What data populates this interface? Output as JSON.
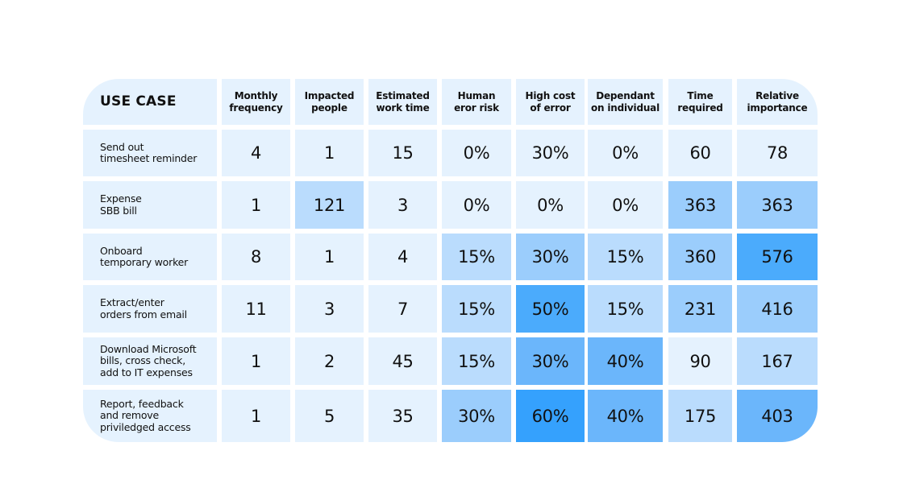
{
  "chart_data": {
    "type": "heatmap",
    "title": "",
    "corner_header": "USE CASE",
    "columns": [
      "Monthly\nfrequency",
      "Impacted\npeople",
      "Estimated\nwork time",
      "Human\neror risk",
      "High cost\nof error",
      "Dependant\non individual",
      "Time\nrequired",
      "Relative\nimportance"
    ],
    "rows": [
      {
        "label": "Send out\ntimesheet reminder",
        "values": [
          "4",
          "1",
          "15",
          "0%",
          "30%",
          "0%",
          "60",
          "78"
        ],
        "shades": [
          0,
          0,
          0,
          0,
          0,
          0,
          0,
          0
        ]
      },
      {
        "label": "Expense\nSBB bill",
        "values": [
          "1",
          "121",
          "3",
          "0%",
          "0%",
          "0%",
          "363",
          "363"
        ],
        "shades": [
          0,
          1,
          0,
          0,
          0,
          0,
          2,
          2
        ]
      },
      {
        "label": "Onboard\ntemporary worker",
        "values": [
          "8",
          "1",
          "4",
          "15%",
          "30%",
          "15%",
          "360",
          "576"
        ],
        "shades": [
          0,
          0,
          0,
          1,
          2,
          1,
          2,
          4
        ]
      },
      {
        "label": "Extract/enter\norders from email",
        "values": [
          "11",
          "3",
          "7",
          "15%",
          "50%",
          "15%",
          "231",
          "416"
        ],
        "shades": [
          0,
          0,
          0,
          1,
          4,
          1,
          2,
          2
        ]
      },
      {
        "label": "Download Microsoft\nbills, cross check,\nadd to IT expenses",
        "values": [
          "1",
          "2",
          "45",
          "15%",
          "30%",
          "40%",
          "90",
          "167"
        ],
        "shades": [
          0,
          0,
          0,
          1,
          3,
          3,
          0,
          1
        ]
      },
      {
        "label": "Report, feedback\nand remove\npriviledged access",
        "values": [
          "1",
          "5",
          "35",
          "30%",
          "60%",
          "40%",
          "175",
          "403"
        ],
        "shades": [
          0,
          0,
          0,
          2,
          5,
          3,
          1,
          3
        ]
      }
    ],
    "shade_scale": [
      "#e5f2fe",
      "#badcfd",
      "#9bcdfc",
      "#6bb6fb",
      "#4babfc",
      "#35a1fd"
    ],
    "header_color": "#e5f2fe"
  }
}
